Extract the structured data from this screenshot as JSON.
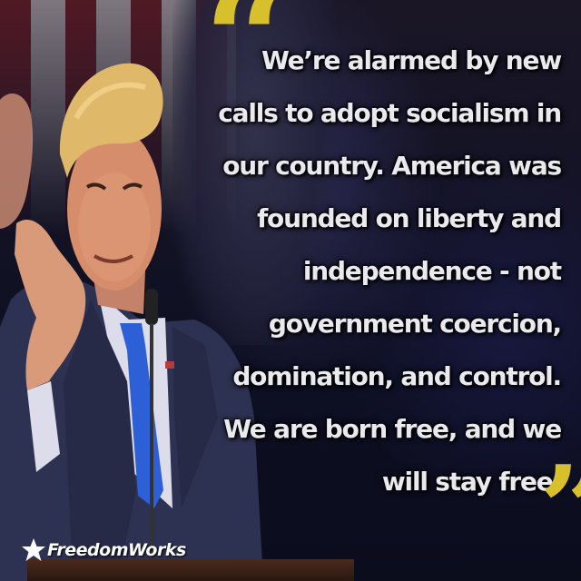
{
  "quote": {
    "lines": [
      "We’re alarmed by new",
      "calls to adopt socialism in",
      "our country.  America was",
      "founded on liberty and",
      "independence - not",
      "government coercion,",
      "domination, and control.",
      "We are born free, and we",
      "will stay free."
    ],
    "open_mark": "“",
    "close_mark": "”",
    "text_color": "#e9e9ee",
    "mark_color": "#d8c02c"
  },
  "logo": {
    "text": "FreedomWorks",
    "icon": "star-icon"
  },
  "photo": {
    "subject": "speaker-photo",
    "tie_color": "#2d5fd6",
    "suit_color": "#2e3252",
    "flag_red": "#7e1d24"
  }
}
